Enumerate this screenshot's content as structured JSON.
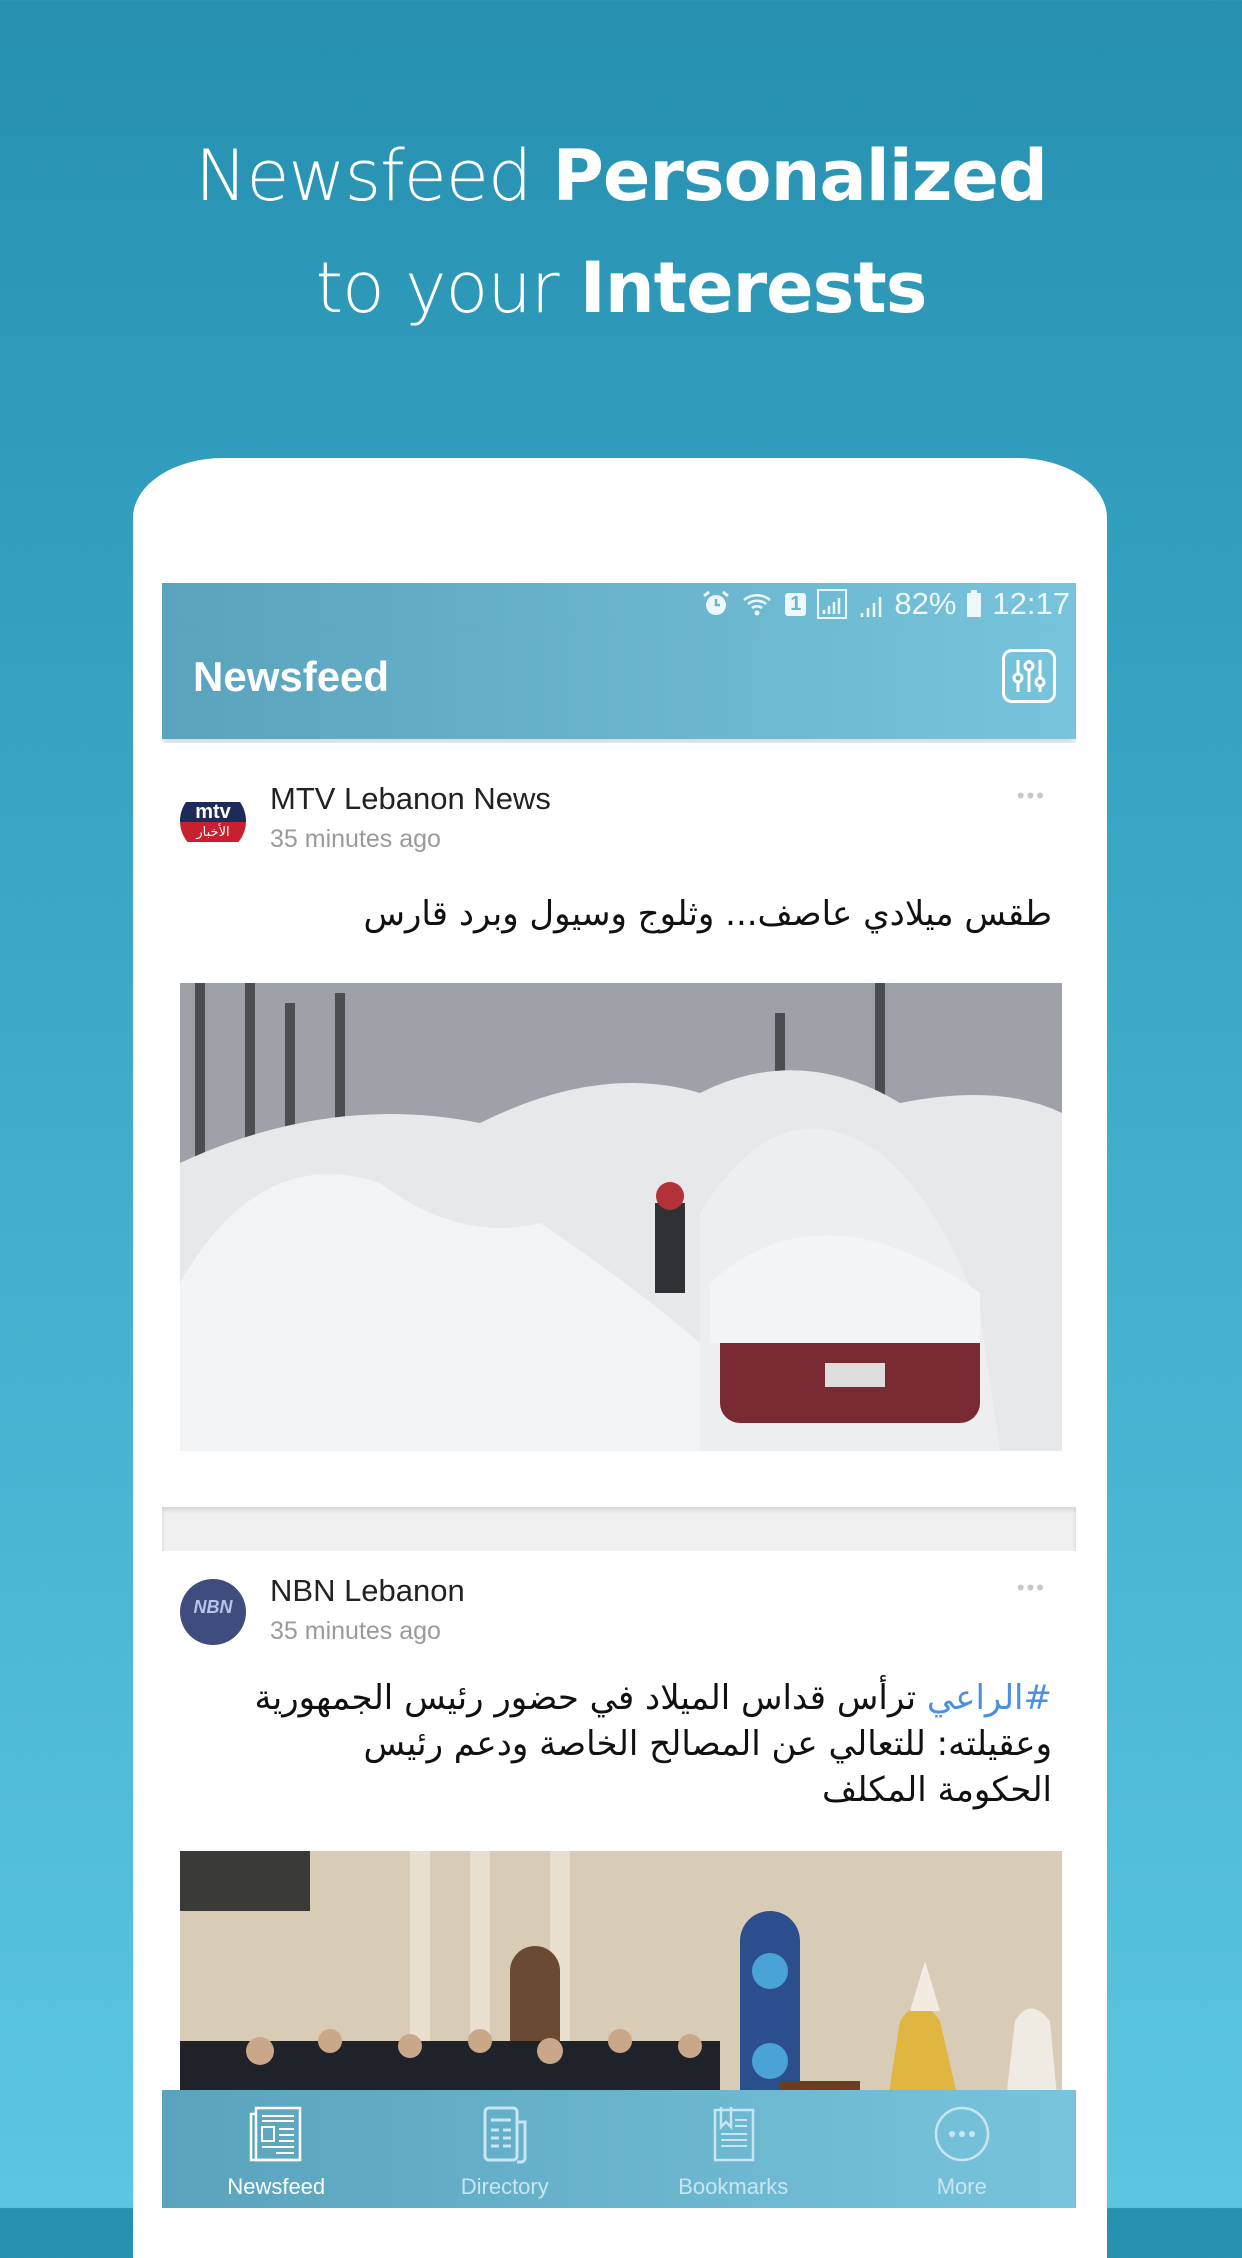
{
  "promo": {
    "line1_light": "Newsfeed ",
    "line1_bold": "Personalized",
    "line2_light": "to your ",
    "line2_bold": "Interests"
  },
  "status_bar": {
    "icons": [
      "alarm-icon",
      "wifi-icon",
      "sim-1-icon",
      "signal-box-icon",
      "signal-icon",
      "battery-icon"
    ],
    "sim_label": "1",
    "battery": "82%",
    "time": "12:17"
  },
  "app_bar": {
    "title": "Newsfeed",
    "filter_icon": "sliders-icon"
  },
  "posts": [
    {
      "source": "MTV Lebanon News",
      "avatar_label": "mtv",
      "avatar_sub": "الأخبار",
      "time": "35 minutes ago",
      "more": "•••",
      "hashtag": "",
      "text": "طقس ميلادي عاصف... وثلوج وسيول وبرد قارس",
      "image": "Snow-covered street with person shoveling beside buried red car"
    },
    {
      "source": "NBN Lebanon",
      "avatar_label": "NBN",
      "time": "35 minutes ago",
      "more": "•••",
      "hashtag": "#الراعي",
      "text": " ترأس قداس الميلاد في حضور رئيس الجمهورية وعقيلته: للتعالي عن المصالح الخاصة ودعم رئيس الحكومة المكلف",
      "image": "Christmas mass in church with officials and patriarch"
    }
  ],
  "tab_bar": {
    "tabs": [
      {
        "label": "Newsfeed",
        "icon": "newspaper-icon",
        "active": true
      },
      {
        "label": "Directory",
        "icon": "directory-icon",
        "active": false
      },
      {
        "label": "Bookmarks",
        "icon": "bookmark-book-icon",
        "active": false
      },
      {
        "label": "More",
        "icon": "more-circle-icon",
        "active": false
      }
    ]
  },
  "colors": {
    "background_top": "#2790b1",
    "background_bottom": "#5cc6e2",
    "app_bar": "#6bb4cd",
    "hashtag": "#4a90e2",
    "mtv_red": "#c8202f",
    "mtv_blue": "#1d2b5a",
    "nbn_blue": "#3e4d7e"
  }
}
